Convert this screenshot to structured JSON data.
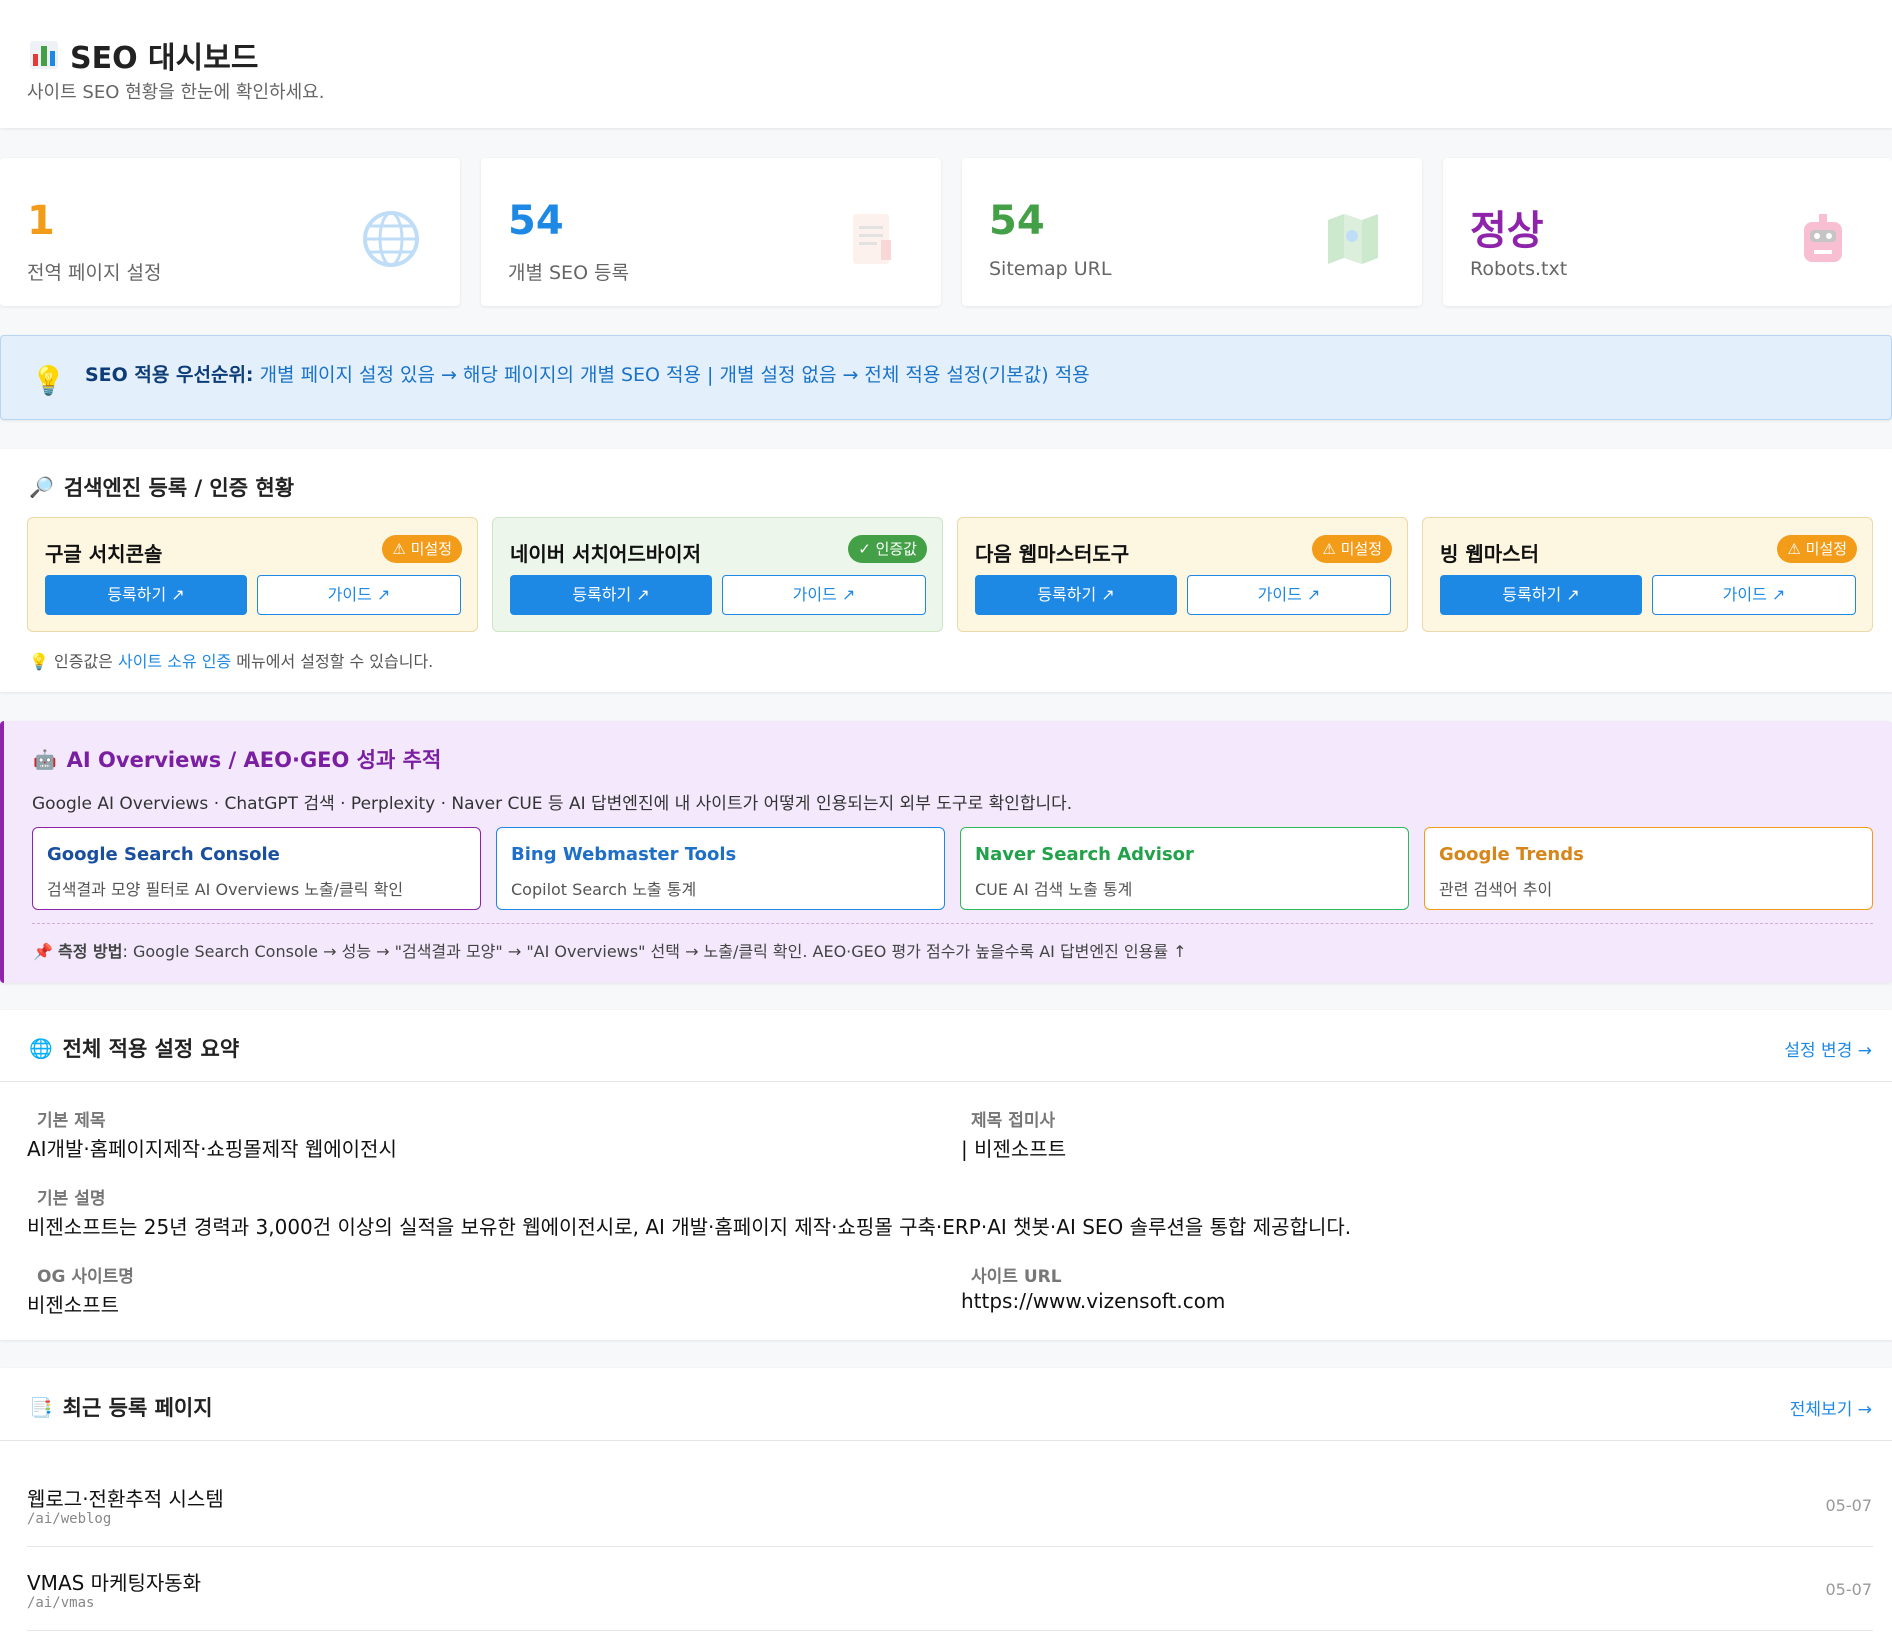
{
  "header": {
    "title": "SEO 대시보드",
    "subtitle": "사이트 SEO 현황을 한눈에 확인하세요."
  },
  "stats": [
    {
      "value": "1",
      "label": "전역 페이지 설정",
      "color": "#f39c1a",
      "icon": "globe-icon"
    },
    {
      "value": "54",
      "label": "개별 SEO 등록",
      "color": "#1e88e5",
      "icon": "document-icon"
    },
    {
      "value": "54",
      "label": "Sitemap URL",
      "color": "#43a047",
      "icon": "map-icon"
    },
    {
      "value": "정상",
      "label": "Robots.txt",
      "color": "#8e24aa",
      "icon": "robot-icon"
    }
  ],
  "notice": {
    "bold": "SEO 적용 우선순위:",
    "text": " 개별 페이지 설정 있음 → 해당 페이지의 개별 SEO 적용 | 개별 설정 없음 → 전체 적용 설정(기본값) 적용"
  },
  "engines": {
    "title": "검색엔진 등록 / 인증 현황",
    "items": [
      {
        "name": "구글 서치콘솔",
        "badge": "⚠ 미설정",
        "register": "등록하기 ↗",
        "guide": "가이드 ↗"
      },
      {
        "name": "네이버 서치어드바이저",
        "badge": "✓ 인증값",
        "register": "등록하기 ↗",
        "guide": "가이드 ↗"
      },
      {
        "name": "다음 웹마스터도구",
        "badge": "⚠ 미설정",
        "register": "등록하기 ↗",
        "guide": "가이드 ↗"
      },
      {
        "name": "빙 웹마스터",
        "badge": "⚠ 미설정",
        "register": "등록하기 ↗",
        "guide": "가이드 ↗"
      }
    ],
    "hint_pre": "인증값은 ",
    "hint_link": "사이트 소유 인증",
    "hint_post": " 메뉴에서 설정할 수 있습니다."
  },
  "ai": {
    "title": "AI Overviews / AEO·GEO 성과 추적",
    "desc": "Google AI Overviews · ChatGPT 검색 · Perplexity · Naver CUE 등 AI 답변엔진에 내 사이트가 어떻게 인용되는지 외부 도구로 확인합니다.",
    "tools": [
      {
        "name": "Google Search Console",
        "desc": "검색결과 모양 필터로 AI Overviews 노출/클릭 확인",
        "color": "#8e24aa",
        "text_color": "#1a4fa0"
      },
      {
        "name": "Bing Webmaster Tools",
        "desc": "Copilot Search 노출 통계",
        "color": "#1e88e5",
        "text_color": "#1e6fc8"
      },
      {
        "name": "Naver Search Advisor",
        "desc": "CUE AI 검색 노출 통계",
        "color": "#2eb85c",
        "text_color": "#21a24a"
      },
      {
        "name": "Google Trends",
        "desc": "관련 검색어 추이",
        "color": "#f39c1a",
        "text_color": "#d6861a"
      }
    ],
    "method_label": "측정 방법",
    "method_text": ": Google Search Console → 성능 → \"검색결과 모양\" → \"AI Overviews\" 선택 → 노출/클릭 확인. AEO·GEO 평가 점수가 높을수록 AI 답변엔진 인용률 ↑"
  },
  "summary": {
    "title": "전체 적용 설정 요약",
    "change": "설정 변경 →",
    "base_title_label": "기본 제목",
    "base_title": "AI개발·홈페이지제작·쇼핑몰제작 웹에이전시",
    "suffix_label": "제목 접미사",
    "suffix": "| 비젠소프트",
    "desc_label": "기본 설명",
    "desc": "비젠소프트는 25년 경력과 3,000건 이상의 실적을 보유한 웹에이전시로, AI 개발·홈페이지 제작·쇼핑몰 구축·ERP·AI 챗봇·AI SEO 솔루션을 통합 제공합니다.",
    "og_label": "OG 사이트명",
    "og": "비젠소프트",
    "url_label": "사이트 URL",
    "url": "https://www.vizensoft.com"
  },
  "recent": {
    "title": "최근 등록 페이지",
    "all": "전체보기 →",
    "rows": [
      {
        "title": "웹로그·전환추적 시스템",
        "path": "/ai/weblog",
        "date": "05-07"
      },
      {
        "title": "VMAS 마케팅자동화",
        "path": "/ai/vmas",
        "date": "05-07"
      }
    ]
  }
}
